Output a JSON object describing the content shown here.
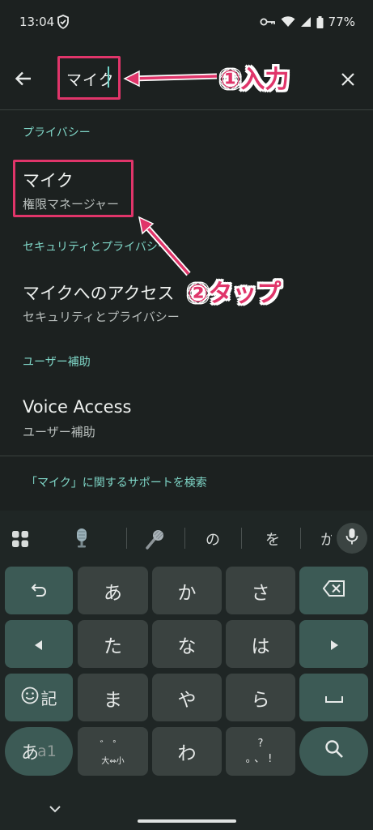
{
  "status_bar": {
    "time": "13:04",
    "battery": "77%"
  },
  "search": {
    "query": "マイク"
  },
  "results": [
    {
      "section": "プライバシー",
      "title": "マイク",
      "subtitle": "権限マネージャー"
    },
    {
      "section": "セキュリティとプライバシー",
      "title": "マイクへのアクセス",
      "subtitle": "セキュリティとプライバシー"
    },
    {
      "section": "ユーザー補助",
      "title": "Voice Access",
      "subtitle": "ユーザー補助"
    }
  ],
  "support_link": "「マイク」に関するサポートを検索",
  "annotations": {
    "step1": "①入力",
    "step2": "②タップ"
  },
  "keyboard": {
    "suggestions": [
      "の",
      "を",
      "か"
    ],
    "rows": [
      [
        "あ",
        "か",
        "さ"
      ],
      [
        "た",
        "な",
        "は"
      ],
      [
        "ま",
        "や",
        "ら"
      ],
      [
        "わ"
      ]
    ],
    "emoji_key": "記",
    "mode_key_main": "あ",
    "mode_key_sub": "a1",
    "dakuten_key_bottom": "大⇔小",
    "punct_key_top": "?",
    "punct_key_bottom": "。、!"
  },
  "colors": {
    "accent": "#e0356a",
    "link": "#7fd6c7",
    "background": "#1c2120"
  }
}
